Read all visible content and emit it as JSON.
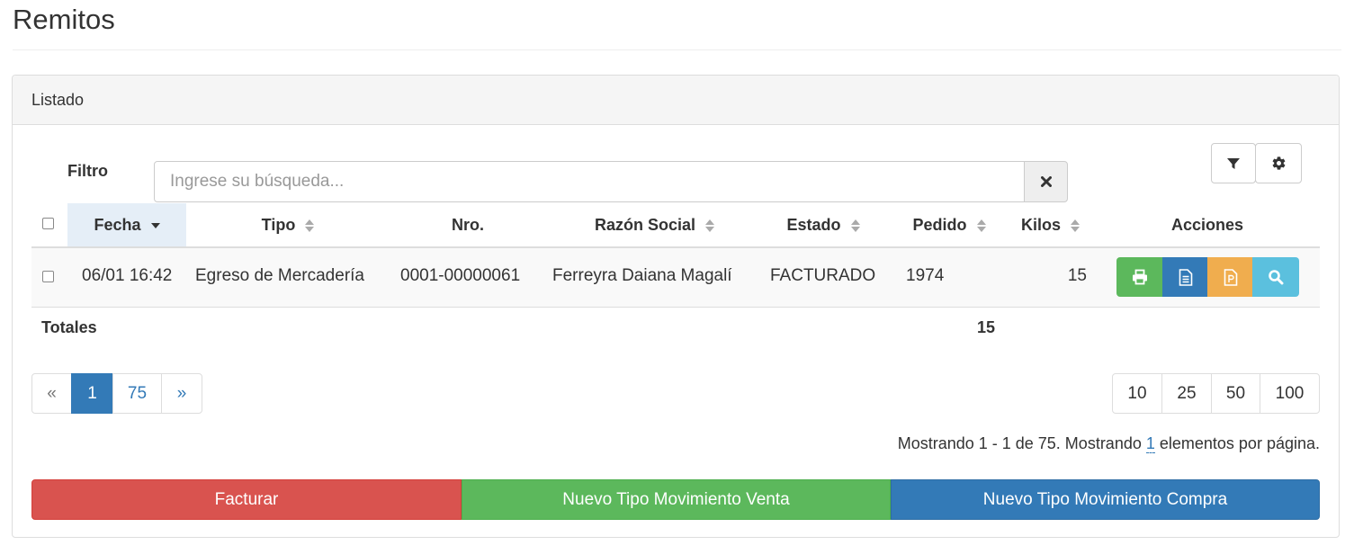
{
  "page": {
    "title": "Remitos"
  },
  "panel": {
    "heading": "Listado"
  },
  "filter": {
    "label": "Filtro",
    "placeholder": "Ingrese su búsqueda...",
    "value": ""
  },
  "toolbar": {
    "filter_icon": "filter-icon",
    "settings_icon": "gear-icon"
  },
  "table": {
    "columns": [
      "Fecha",
      "Tipo",
      "Nro.",
      "Razón Social",
      "Estado",
      "Pedido",
      "Kilos",
      "Acciones"
    ],
    "sorted_column": "Fecha",
    "rows": [
      {
        "fecha": "06/01 16:42",
        "tipo": "Egreso de Mercadería",
        "nro": "0001-00000061",
        "razon_social": "Ferreyra Daiana Magalí",
        "estado": "FACTURADO",
        "pedido": "1974",
        "kilos": "15"
      }
    ],
    "row_actions": [
      {
        "icon": "print-icon",
        "color": "#5cb85c"
      },
      {
        "icon": "document-icon",
        "color": "#337ab7"
      },
      {
        "icon": "pdf-document-icon",
        "color": "#f0ad4e"
      },
      {
        "icon": "search-icon",
        "color": "#5bc0de"
      }
    ],
    "totals": {
      "label": "Totales",
      "kilos": "15"
    }
  },
  "pagination": {
    "prev": "«",
    "pages": [
      "1",
      "75"
    ],
    "current": "1",
    "next": "»"
  },
  "page_sizes": [
    "10",
    "25",
    "50",
    "100"
  ],
  "status": {
    "prefix": "Mostrando 1 - 1 de 75. Mostrando ",
    "per_page": "1",
    "suffix": " elementos por página."
  },
  "actions": {
    "facturar": "Facturar",
    "nuevo_venta": "Nuevo Tipo Movimiento Venta",
    "nuevo_compra": "Nuevo Tipo Movimiento Compra"
  },
  "colors": {
    "danger": "#d9534f",
    "success": "#5cb85c",
    "primary": "#337ab7",
    "warning": "#f0ad4e",
    "info": "#5bc0de"
  }
}
